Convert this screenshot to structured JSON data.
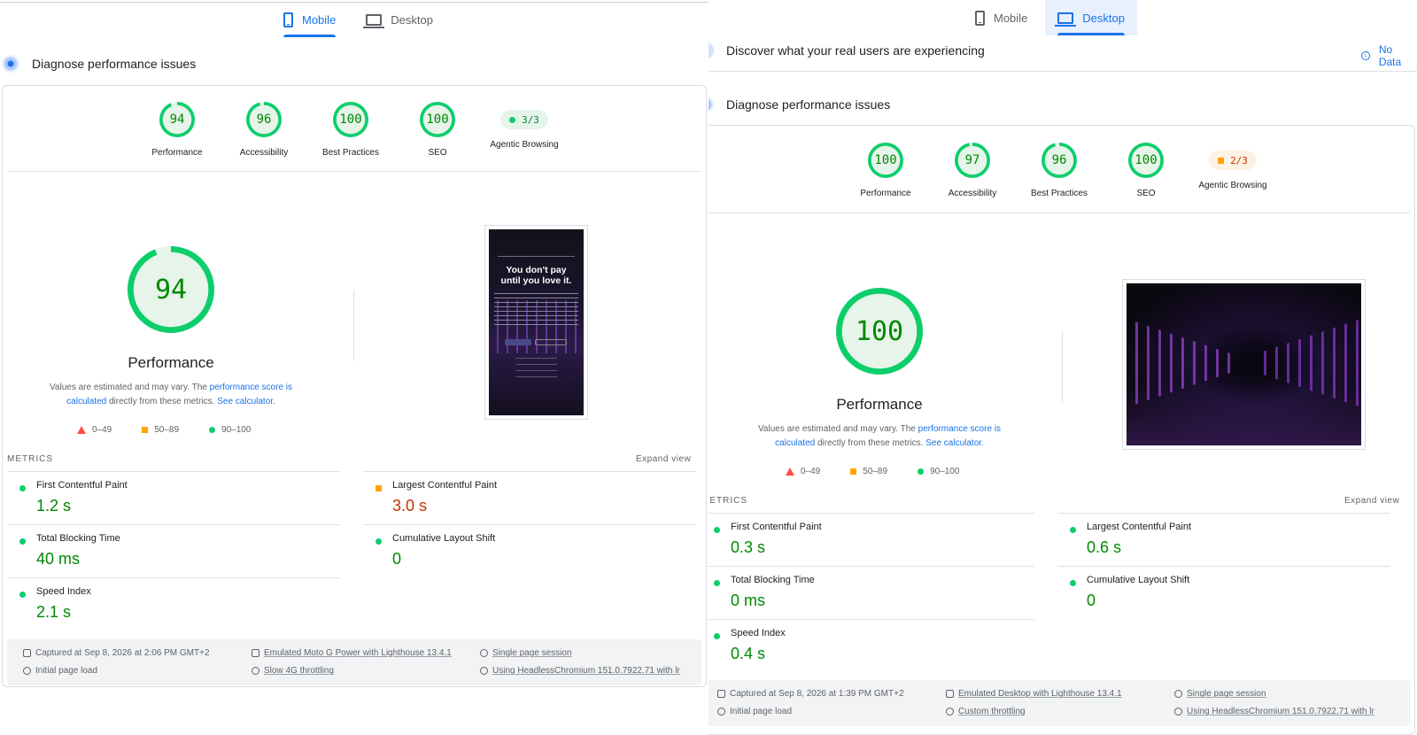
{
  "left": {
    "tabs": [
      {
        "label": "Mobile",
        "icon": "phone-icon",
        "active": true
      },
      {
        "label": "Desktop",
        "icon": "laptop-icon",
        "active": false
      }
    ],
    "diagnose_title": "Diagnose performance issues",
    "categories": [
      {
        "label": "Performance",
        "score": "94",
        "p": 94
      },
      {
        "label": "Accessibility",
        "score": "96",
        "p": 96
      },
      {
        "label": "Best Practices",
        "score": "100",
        "p": 100
      },
      {
        "label": "SEO",
        "score": "100",
        "p": 100
      },
      {
        "label": "Agentic Browsing",
        "score": "3/3",
        "status": "pass"
      }
    ],
    "perf_score": "94",
    "perf_title": "Performance",
    "desc_prefix": "Values are estimated and may vary. The ",
    "desc_link1": "performance score is calculated",
    "desc_mid": " directly from these metrics. ",
    "desc_link2": "See calculator.",
    "legend": [
      "0–49",
      "50–89",
      "90–100"
    ],
    "metrics_header": "METRICS",
    "expand_label": "Expand view",
    "metrics": [
      {
        "label": "First Contentful Paint",
        "value": "1.2 s",
        "rating": "good"
      },
      {
        "label": "Largest Contentful Paint",
        "value": "3.0 s",
        "rating": "average"
      },
      {
        "label": "Total Blocking Time",
        "value": "40 ms",
        "rating": "good"
      },
      {
        "label": "Cumulative Layout Shift",
        "value": "0",
        "rating": "good"
      },
      {
        "label": "Speed Index",
        "value": "2.1 s",
        "rating": "good"
      }
    ],
    "screenshot": {
      "heading": "You don't pay until you love it."
    },
    "footer": {
      "captured": "Captured at Sep 8, 2026 at 2:06 PM GMT+2",
      "initial": "Initial page load",
      "emulated": "Emulated Moto G Power with Lighthouse 13.4.1",
      "throttling": "Slow 4G throttling",
      "session": "Single page session",
      "browser": "Using HeadlessChromium 151.0.7922.71 with lr"
    }
  },
  "right": {
    "tabs": [
      {
        "label": "Mobile",
        "icon": "phone-icon",
        "active": false
      },
      {
        "label": "Desktop",
        "icon": "laptop-icon",
        "active": true
      }
    ],
    "discover_title": "Discover what your real users are experiencing",
    "no_data": "No Data",
    "diagnose_title": "Diagnose performance issues",
    "categories": [
      {
        "label": "Performance",
        "score": "100",
        "p": 100
      },
      {
        "label": "Accessibility",
        "score": "97",
        "p": 97
      },
      {
        "label": "Best Practices",
        "score": "96",
        "p": 96
      },
      {
        "label": "SEO",
        "score": "100",
        "p": 100
      },
      {
        "label": "Agentic Browsing",
        "score": "2/3",
        "status": "average"
      }
    ],
    "perf_score": "100",
    "perf_title": "Performance",
    "desc_prefix": "Values are estimated and may vary. The ",
    "desc_link1": "performance score is calculated",
    "desc_mid": " directly from these metrics. ",
    "desc_link2": "See calculator.",
    "legend": [
      "0–49",
      "50–89",
      "90–100"
    ],
    "metrics_header": "METRICS",
    "expand_label": "Expand view",
    "metrics": [
      {
        "label": "First Contentful Paint",
        "value": "0.3 s",
        "rating": "good"
      },
      {
        "label": "Largest Contentful Paint",
        "value": "0.6 s",
        "rating": "good"
      },
      {
        "label": "Total Blocking Time",
        "value": "0 ms",
        "rating": "good"
      },
      {
        "label": "Cumulative Layout Shift",
        "value": "0",
        "rating": "good"
      },
      {
        "label": "Speed Index",
        "value": "0.4 s",
        "rating": "good"
      }
    ],
    "footer": {
      "captured": "Captured at Sep 8, 2026 at 1:39 PM GMT+2",
      "initial": "Initial page load",
      "emulated": "Emulated Desktop with Lighthouse 13.4.1",
      "throttling": "Custom throttling",
      "session": "Single page session",
      "browser": "Using HeadlessChromium 151.0.7922.71 with lr"
    }
  },
  "colors": {
    "good": "#0cce6b",
    "average": "#ffa400",
    "poor": "#ff4e42",
    "link": "#1a73e8"
  }
}
